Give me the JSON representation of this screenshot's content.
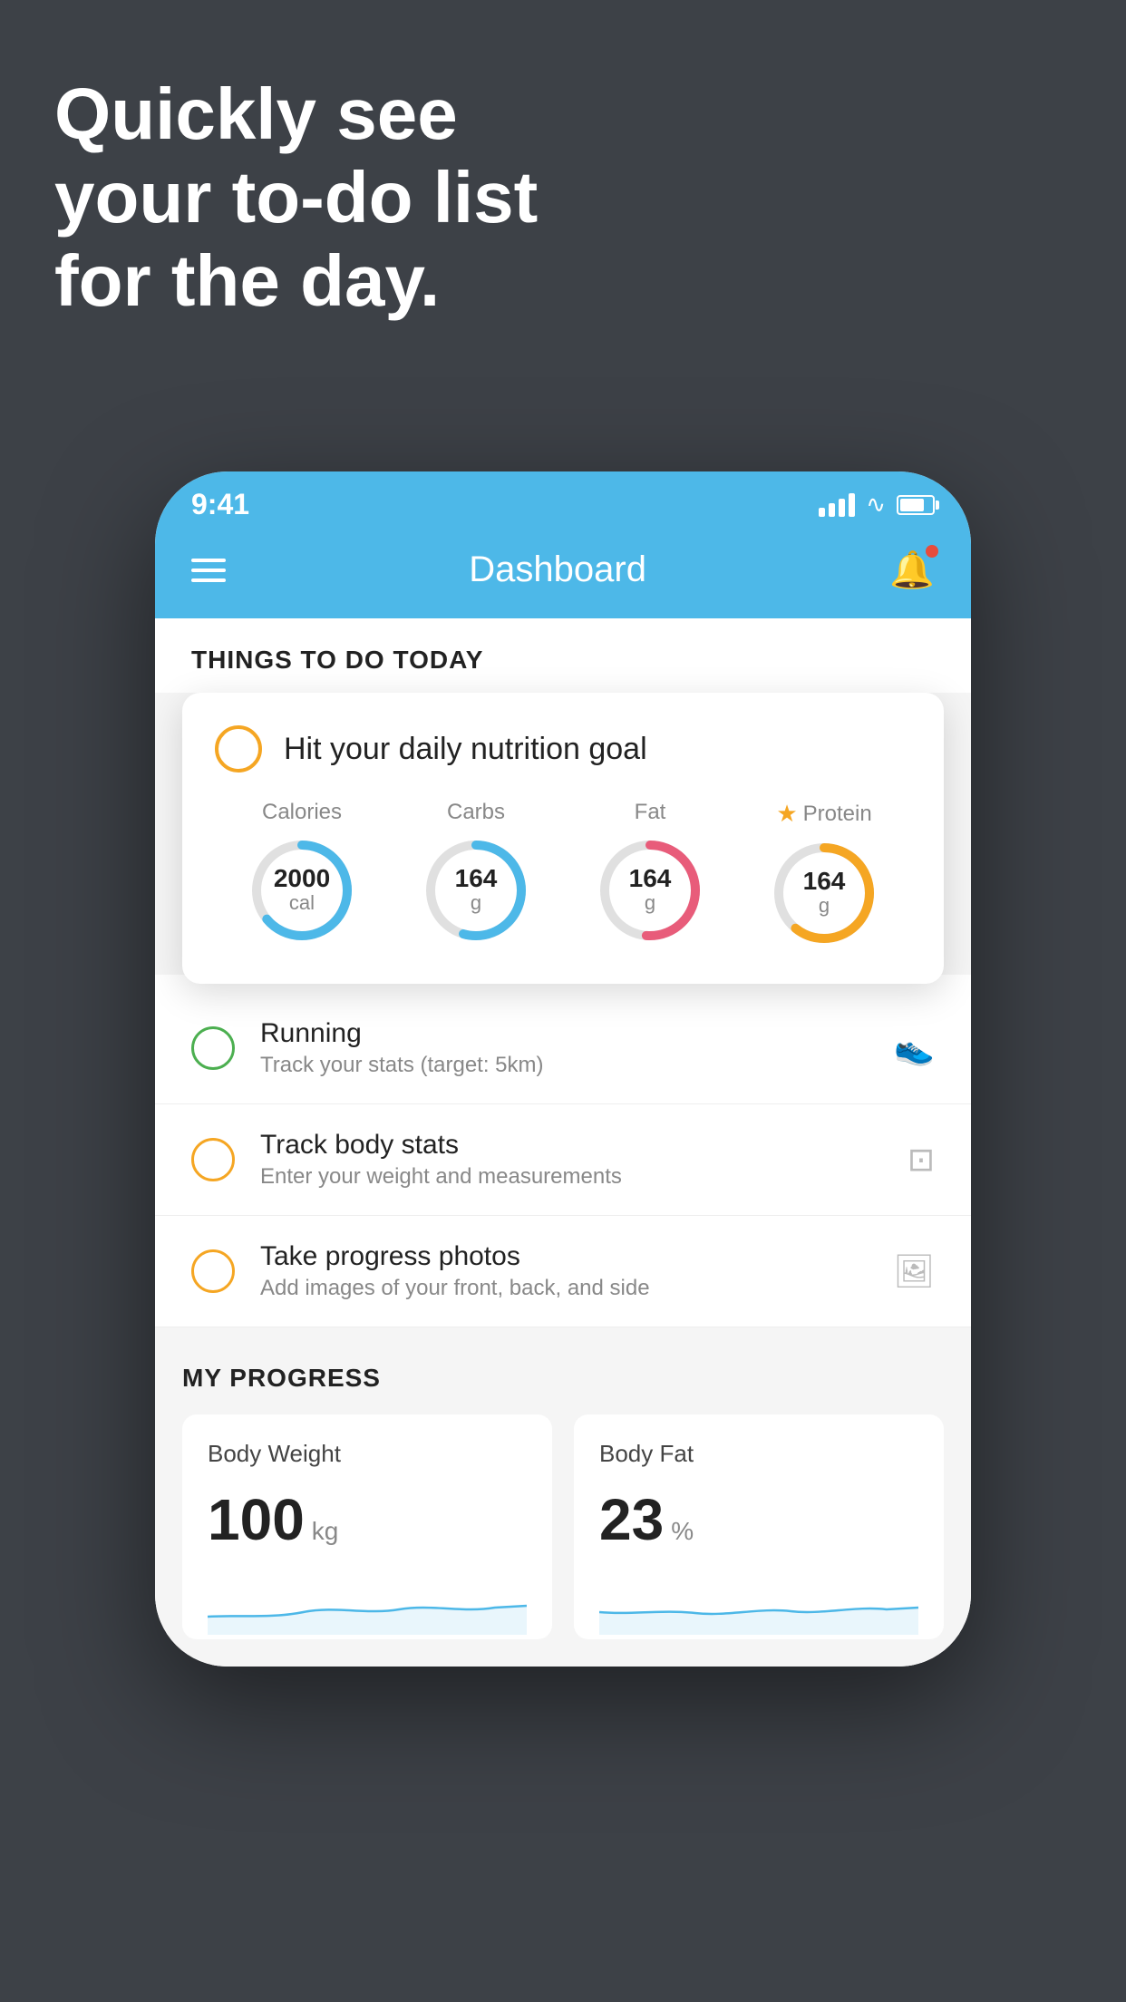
{
  "headline": {
    "line1": "Quickly see",
    "line2": "your to-do list",
    "line3": "for the day."
  },
  "status_bar": {
    "time": "9:41"
  },
  "app_header": {
    "title": "Dashboard"
  },
  "things_today": {
    "section_label": "THINGS TO DO TODAY",
    "nutrition_card": {
      "title": "Hit your daily nutrition goal",
      "calories": {
        "label": "Calories",
        "value": "2000",
        "unit": "cal",
        "color": "#4db8e8"
      },
      "carbs": {
        "label": "Carbs",
        "value": "164",
        "unit": "g",
        "color": "#4db8e8"
      },
      "fat": {
        "label": "Fat",
        "value": "164",
        "unit": "g",
        "color": "#e85c7a"
      },
      "protein": {
        "label": "Protein",
        "value": "164",
        "unit": "g",
        "color": "#f5a623"
      }
    },
    "todo_items": [
      {
        "id": "running",
        "title": "Running",
        "subtitle": "Track your stats (target: 5km)",
        "circle_color": "green",
        "icon": "👟"
      },
      {
        "id": "body-stats",
        "title": "Track body stats",
        "subtitle": "Enter your weight and measurements",
        "circle_color": "yellow",
        "icon": "⚖️"
      },
      {
        "id": "progress-photos",
        "title": "Take progress photos",
        "subtitle": "Add images of your front, back, and side",
        "circle_color": "yellow",
        "icon": "🖼️"
      }
    ]
  },
  "my_progress": {
    "section_label": "MY PROGRESS",
    "body_weight": {
      "title": "Body Weight",
      "value": "100",
      "unit": "kg"
    },
    "body_fat": {
      "title": "Body Fat",
      "value": "23",
      "unit": "%"
    }
  }
}
